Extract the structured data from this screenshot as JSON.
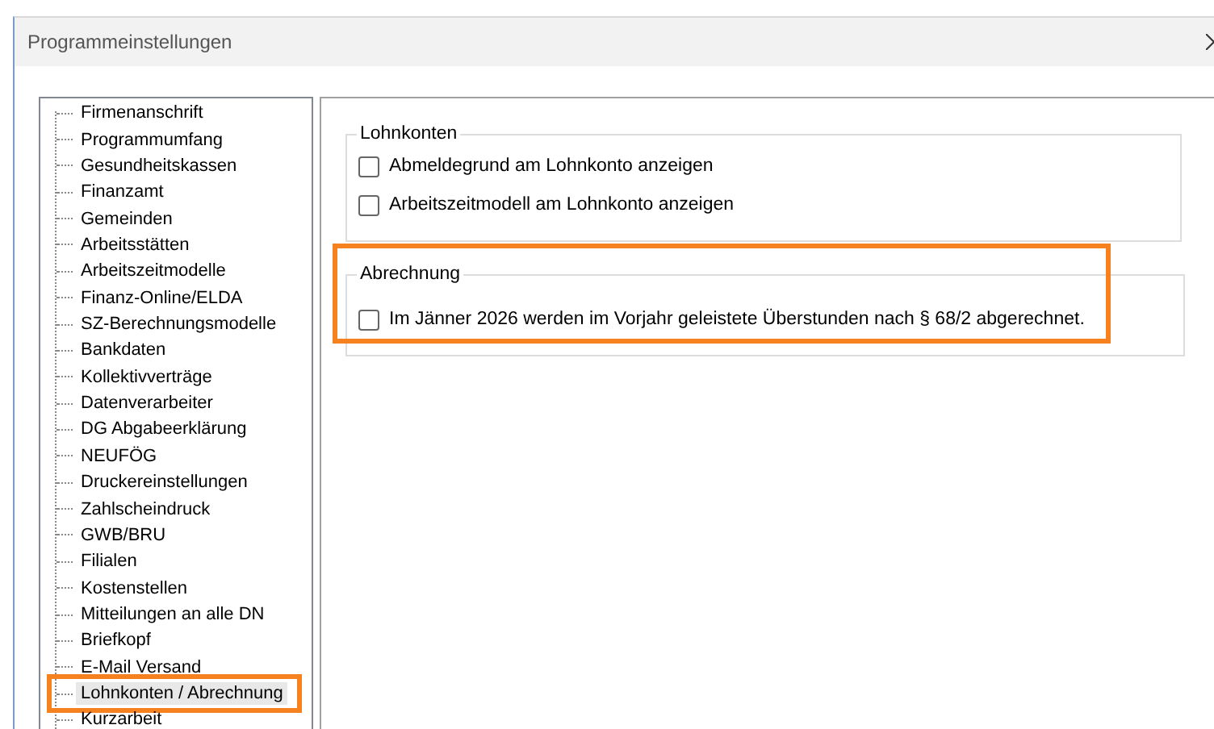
{
  "window": {
    "title": "Programmeinstellungen"
  },
  "tree": {
    "items": [
      {
        "label": "Firmenanschrift",
        "selected": false,
        "highlighted": false
      },
      {
        "label": "Programmumfang",
        "selected": false,
        "highlighted": false
      },
      {
        "label": "Gesundheitskassen",
        "selected": false,
        "highlighted": false
      },
      {
        "label": "Finanzamt",
        "selected": false,
        "highlighted": false
      },
      {
        "label": "Gemeinden",
        "selected": false,
        "highlighted": false
      },
      {
        "label": "Arbeitsstätten",
        "selected": false,
        "highlighted": false
      },
      {
        "label": "Arbeitszeitmodelle",
        "selected": false,
        "highlighted": false
      },
      {
        "label": "Finanz-Online/ELDA",
        "selected": false,
        "highlighted": false
      },
      {
        "label": "SZ-Berechnungsmodelle",
        "selected": false,
        "highlighted": false
      },
      {
        "label": "Bankdaten",
        "selected": false,
        "highlighted": false
      },
      {
        "label": "Kollektivverträge",
        "selected": false,
        "highlighted": false
      },
      {
        "label": "Datenverarbeiter",
        "selected": false,
        "highlighted": false
      },
      {
        "label": "DG Abgabeerklärung",
        "selected": false,
        "highlighted": false
      },
      {
        "label": "NEUFÖG",
        "selected": false,
        "highlighted": false
      },
      {
        "label": "Druckereinstellungen",
        "selected": false,
        "highlighted": false
      },
      {
        "label": "Zahlscheindruck",
        "selected": false,
        "highlighted": false
      },
      {
        "label": "GWB/BRU",
        "selected": false,
        "highlighted": false
      },
      {
        "label": "Filialen",
        "selected": false,
        "highlighted": false
      },
      {
        "label": "Kostenstellen",
        "selected": false,
        "highlighted": false
      },
      {
        "label": "Mitteilungen an alle DN",
        "selected": false,
        "highlighted": false
      },
      {
        "label": "Briefkopf",
        "selected": false,
        "highlighted": false
      },
      {
        "label": "E-Mail Versand",
        "selected": false,
        "highlighted": false
      },
      {
        "label": "Lohnkonten / Abrechnung",
        "selected": true,
        "highlighted": true
      },
      {
        "label": "Kurzarbeit",
        "selected": false,
        "highlighted": false
      }
    ]
  },
  "groups": [
    {
      "title": "Lohnkonten",
      "highlighted": false,
      "options": [
        {
          "label": "Abmeldegrund am Lohnkonto anzeigen",
          "checked": false
        },
        {
          "label": "Arbeitszeitmodell am Lohnkonto anzeigen",
          "checked": false
        }
      ]
    },
    {
      "title": "Abrechnung",
      "highlighted": true,
      "options": [
        {
          "label": "Im Jänner 2026 werden im Vorjahr geleistete Überstunden nach § 68/2 abgerechnet.",
          "checked": false
        }
      ]
    }
  ]
}
